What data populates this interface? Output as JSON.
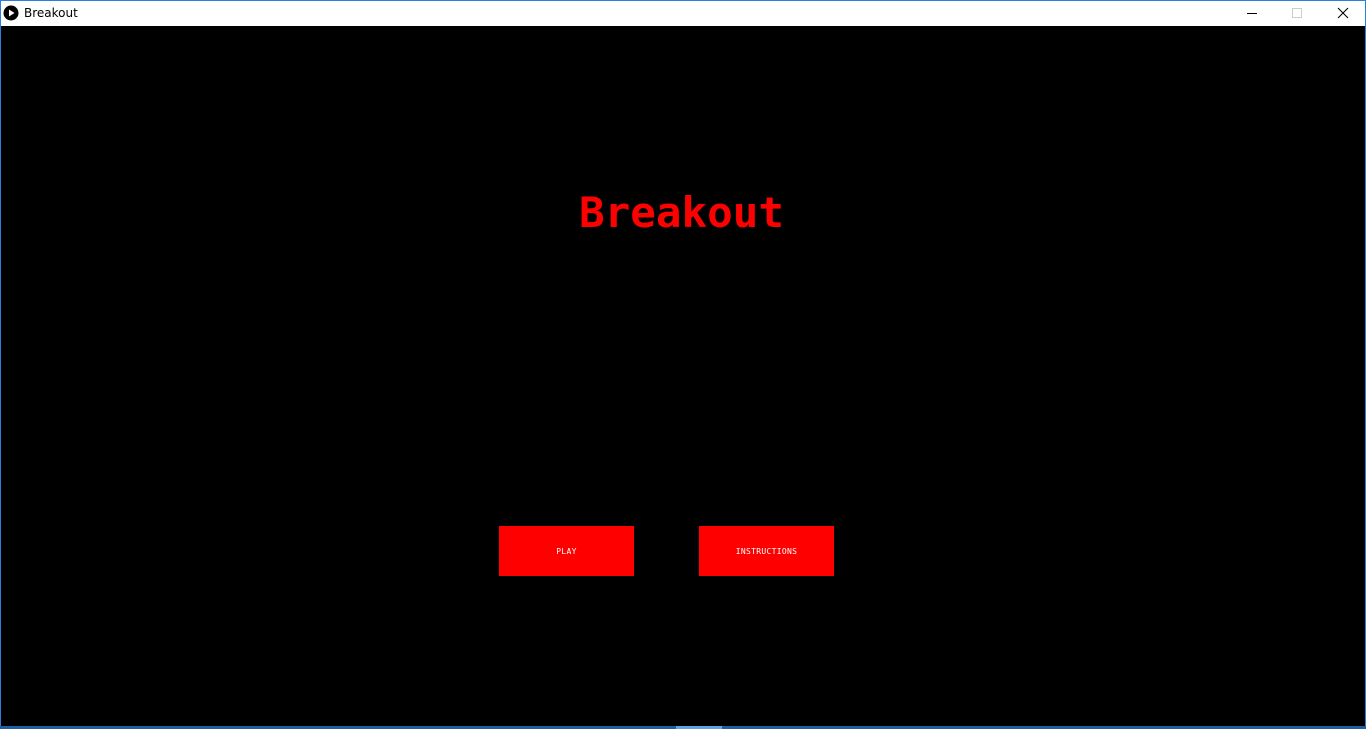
{
  "window": {
    "title": "Breakout",
    "controls": {
      "minimize": "minimize-icon",
      "maximize": "maximize-icon",
      "close": "close-icon"
    }
  },
  "game": {
    "title": "Breakout",
    "buttons": {
      "play": "PLAY",
      "instructions": "INSTRUCTIONS"
    }
  },
  "colors": {
    "background": "#000000",
    "accent": "#ff0000",
    "button_text": "#ffffff",
    "titlebar": "#ffffff",
    "window_border": "#2b7fd6"
  }
}
